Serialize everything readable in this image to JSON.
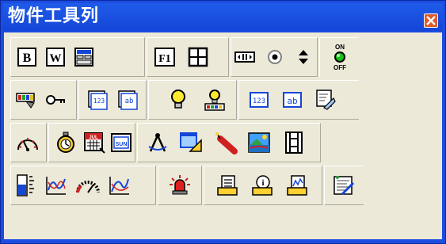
{
  "window": {
    "title": "物件工具列"
  },
  "colors": {
    "titlebar": "#1446d8",
    "close": "#e05a2a",
    "face": "#ece9d8"
  },
  "toolbar": {
    "row1": {
      "bold_label": "B",
      "word_label": "W",
      "function_label": "F1",
      "on_label": "ON",
      "off_label": "OFF"
    },
    "row2": {
      "number_label": "123",
      "text_label": "ab",
      "number_input_label": "123",
      "text_input_label": "ab"
    },
    "row3": {
      "month_label": "JUL",
      "day_label": "SUN"
    }
  }
}
